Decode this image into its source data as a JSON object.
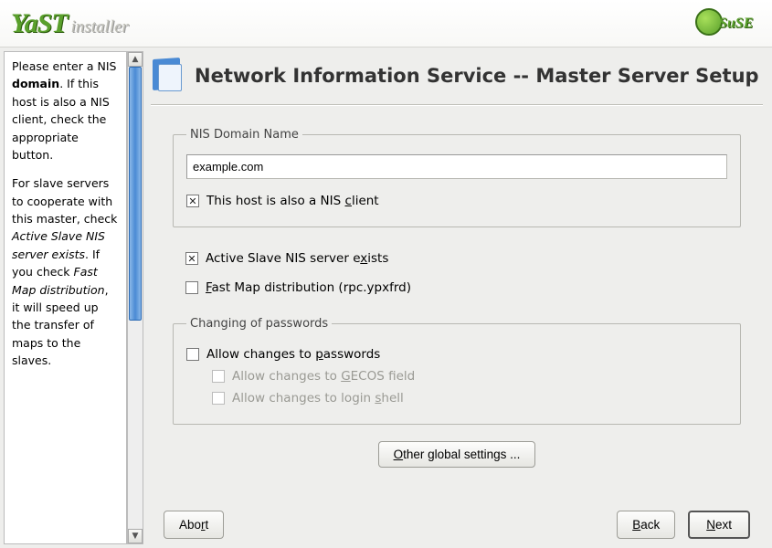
{
  "branding": {
    "yast": "YaST",
    "installer": "installer",
    "suse": "SuSE"
  },
  "help": {
    "p1_a": "Please enter a NIS ",
    "p1_b": "domain",
    "p1_c": ". If this host is also a NIS client, check the appropriate button.",
    "p2_a": "For slave servers to cooperate with this master, check ",
    "p2_b": "Active Slave NIS server exists",
    "p2_c": ". If you check ",
    "p2_d": "Fast Map distribution",
    "p2_e": ", it will speed up the transfer of maps to the slaves."
  },
  "title": "Network Information Service -- Master Server Setup",
  "domain_group": {
    "legend": "NIS Domain Name",
    "value": "example.com",
    "also_client_pre": "This host is also a NIS ",
    "also_client_u": "c",
    "also_client_post": "lient",
    "also_client_checked": true
  },
  "checks": {
    "active_slave_pre": "Active Slave NIS server e",
    "active_slave_u": "x",
    "active_slave_post": "ists",
    "active_slave_checked": true,
    "fast_map_u": "F",
    "fast_map_post": "ast Map distribution (rpc.ypxfrd)",
    "fast_map_checked": false
  },
  "passwords": {
    "legend": "Changing of passwords",
    "allow_pre": "Allow changes to ",
    "allow_u": "p",
    "allow_post": "asswords",
    "allow_checked": false,
    "gecos_pre": "Allow changes to ",
    "gecos_u": "G",
    "gecos_post": "ECOS field",
    "shell_pre": "Allow changes to login ",
    "shell_u": "s",
    "shell_post": "hell"
  },
  "buttons": {
    "other_u": "O",
    "other_post": "ther global settings ...",
    "abort_pre": "Abo",
    "abort_u": "r",
    "abort_post": "t",
    "back_u": "B",
    "back_post": "ack",
    "next_u": "N",
    "next_post": "ext"
  }
}
